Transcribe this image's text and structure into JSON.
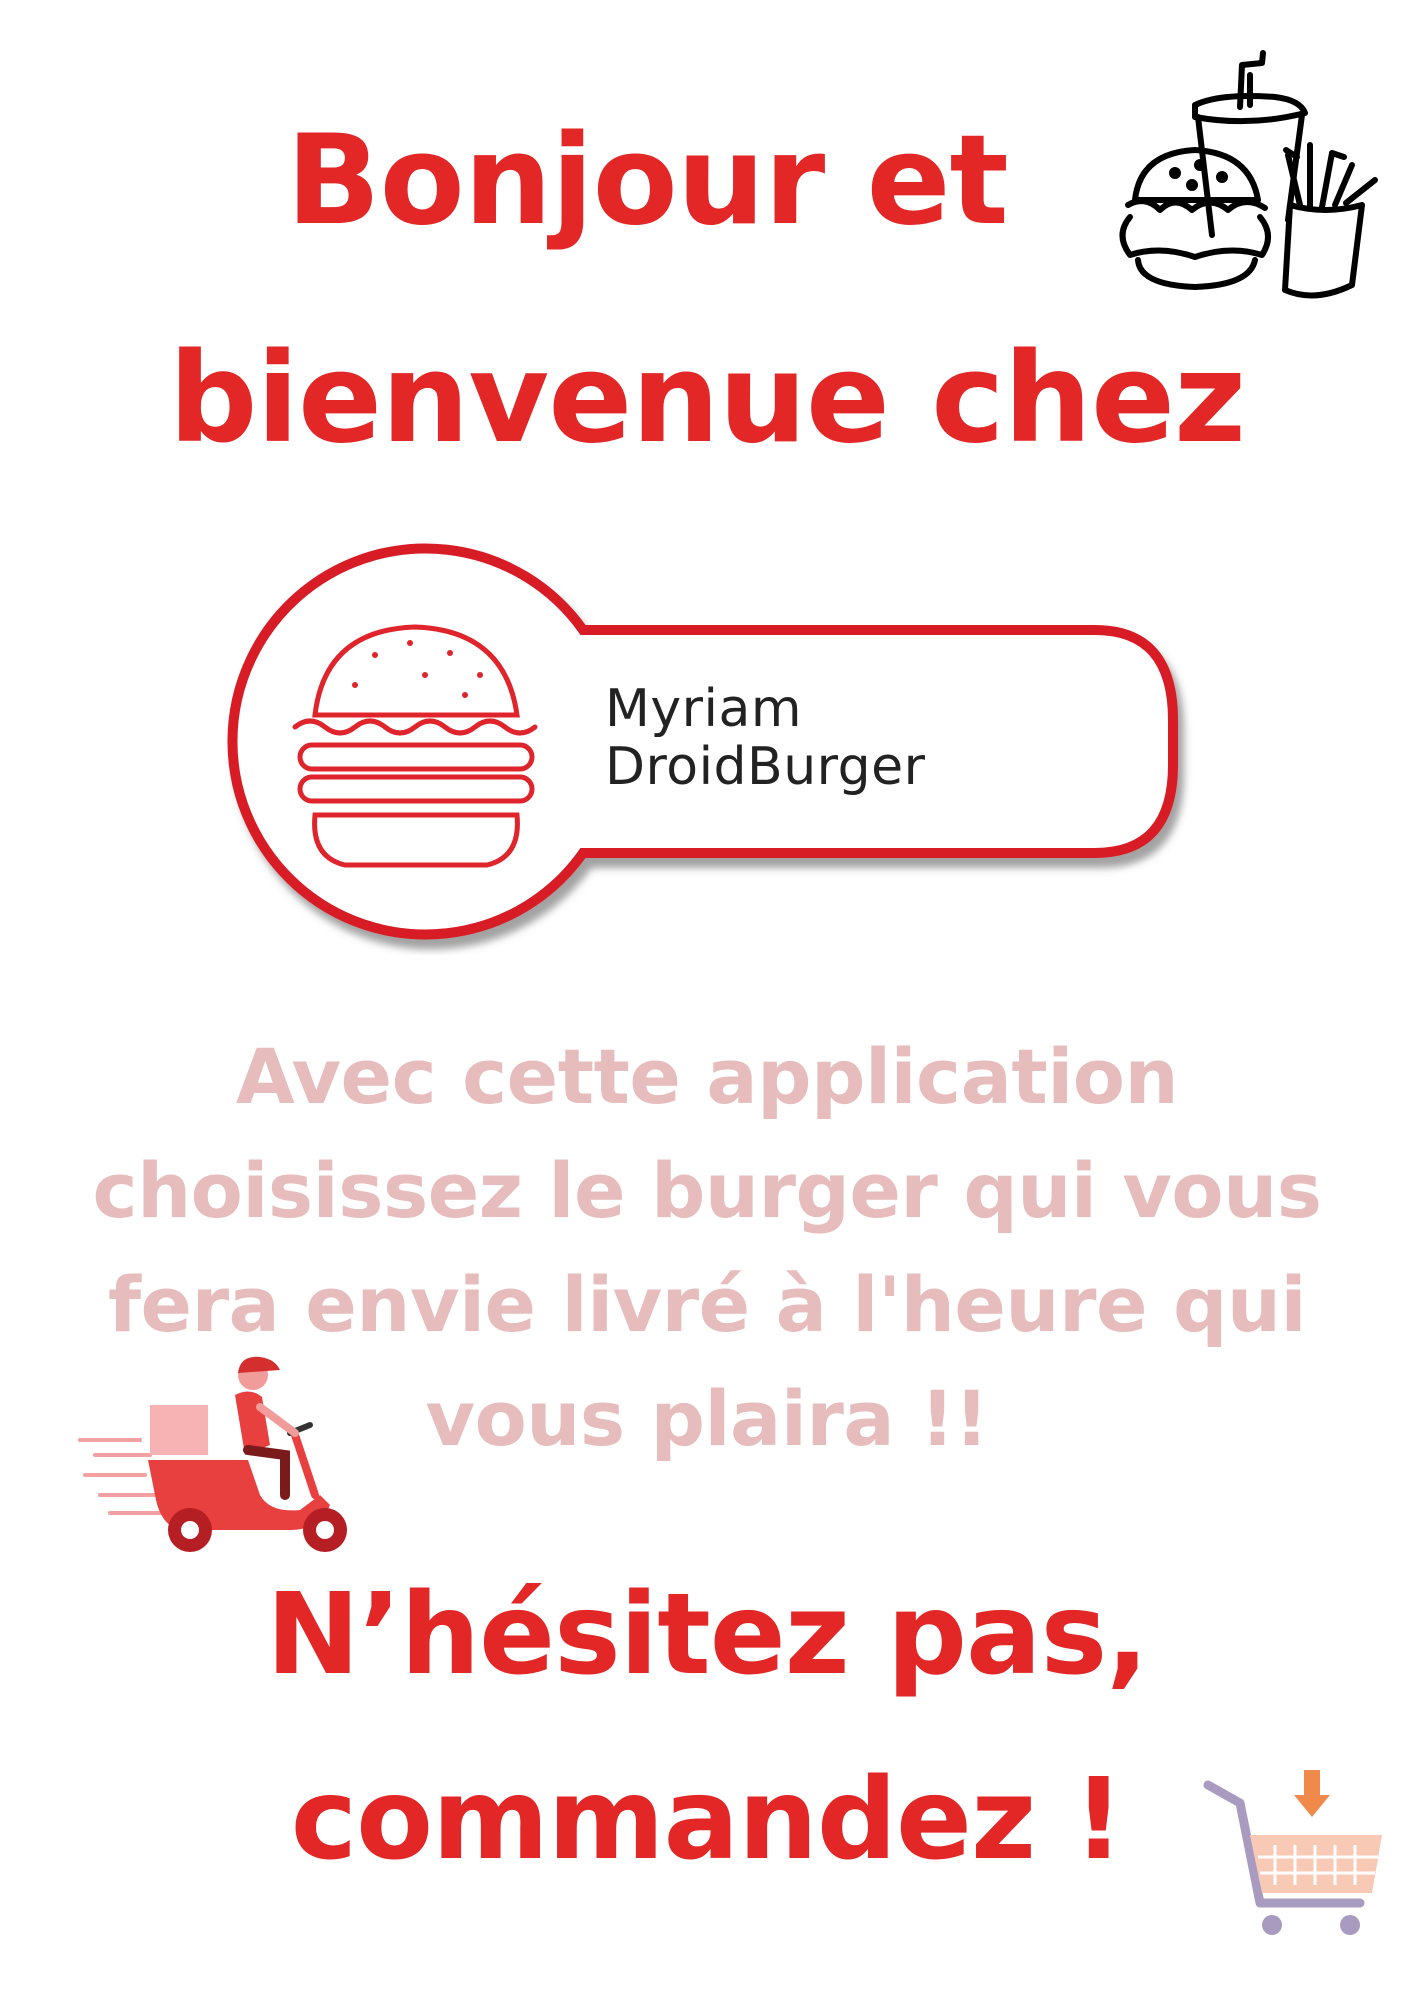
{
  "heading": {
    "line1": "Bonjour et",
    "line2": "bienvenue chez"
  },
  "logo": {
    "brand_line1": "Myriam",
    "brand_line2": "DroidBurger"
  },
  "description": "Avec cette application choisissez le burger qui vous fera envie livré à l'heure qui vous plaira !!",
  "cta": {
    "line1": "N’hésitez pas,",
    "line2": "commandez !"
  },
  "colors": {
    "accent": "#e32626",
    "description_text": "#e6bcbc",
    "logo_text": "#222222"
  },
  "icons": [
    "fast-food-icon",
    "burger-logo-icon",
    "delivery-scooter-icon",
    "shopping-cart-icon"
  ]
}
